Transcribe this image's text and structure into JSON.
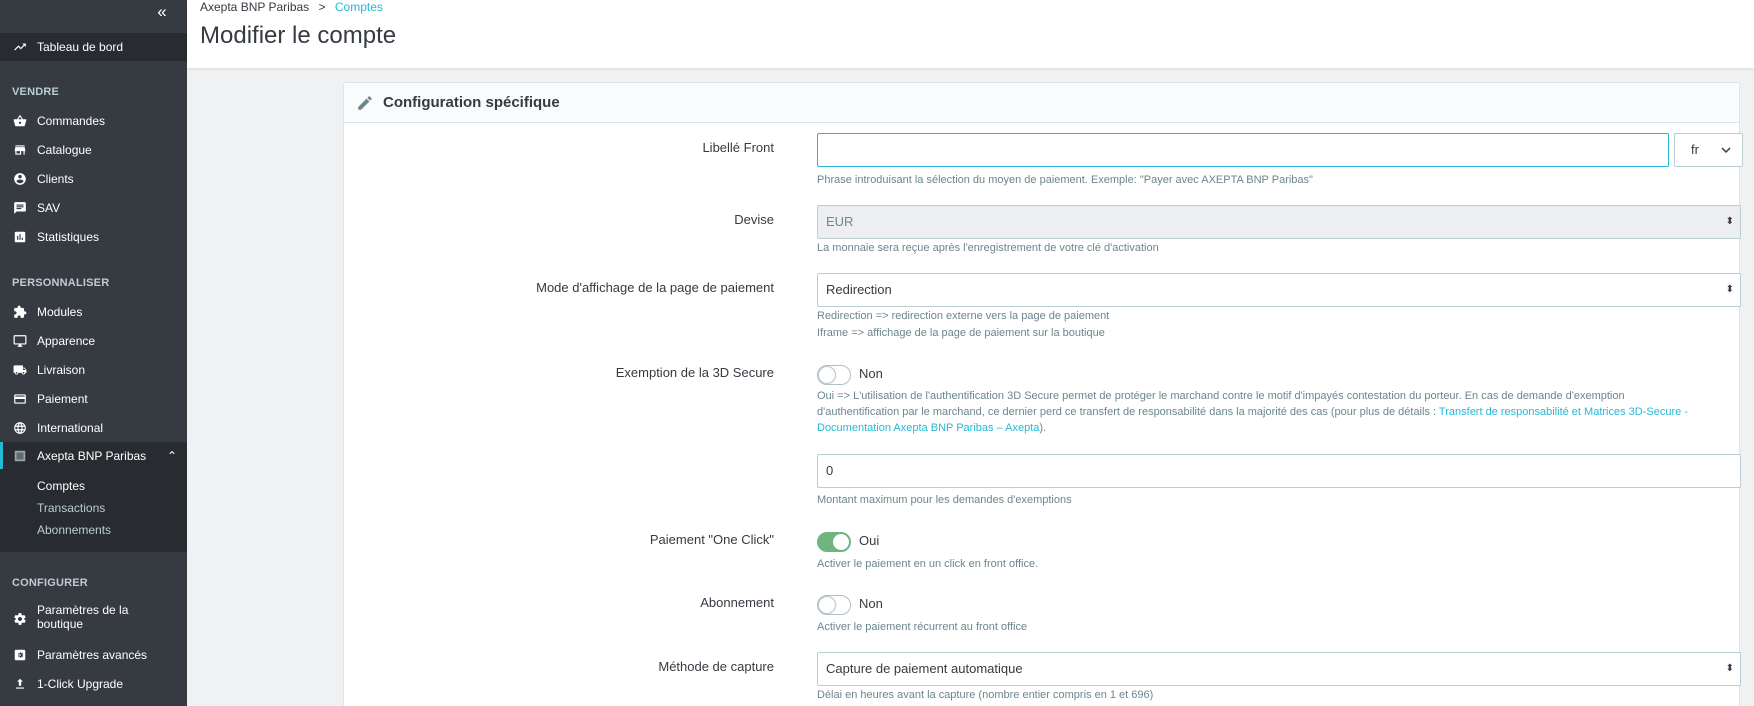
{
  "sidebar": {
    "collapse_icon": "double-chevron-left-icon",
    "dashboard": "Tableau de bord",
    "sections": {
      "sell": "VENDRE",
      "customize": "PERSONNALISER",
      "configure": "CONFIGURER"
    },
    "sell_items": [
      "Commandes",
      "Catalogue",
      "Clients",
      "SAV",
      "Statistiques"
    ],
    "customize_items": [
      "Modules",
      "Apparence",
      "Livraison",
      "Paiement",
      "International"
    ],
    "module": "Axepta BNP Paribas",
    "sub_items": [
      "Comptes",
      "Transactions",
      "Abonnements"
    ],
    "configure_items": [
      "Paramètres de la boutique",
      "Paramètres avancés",
      "1-Click Upgrade"
    ]
  },
  "header": {
    "breadcrumb_parent": "Axepta BNP Paribas",
    "breadcrumb_sep": ">",
    "breadcrumb_current": "Comptes",
    "title": "Modifier le compte"
  },
  "panel": {
    "title": "Configuration spécifique",
    "libelle": {
      "label": "Libellé Front",
      "value": "",
      "lang": "fr",
      "help": "Phrase introduisant la sélection du moyen de paiement. Exemple: \"Payer avec AXEPTA BNP Paribas\""
    },
    "devise": {
      "label": "Devise",
      "value": "EUR",
      "help": "La monnaie sera reçue après l'enregistrement de votre clé d'activation"
    },
    "mode": {
      "label": "Mode d'affichage de la page de paiement",
      "value": "Redirection",
      "help1": "Redirection => redirection externe vers la page de paiement",
      "help2": "Iframe => affichage de la page de paiement sur la boutique"
    },
    "exemption": {
      "label": "Exemption de la 3D Secure",
      "state": "Non",
      "help_line1": "Oui => L'utilisation de l'authentification 3D Secure permet de protéger le marchand contre le motif d'impayés contestation du porteur. En cas de demande d'exemption",
      "help_line2": "d'authentification par le marchand, ce dernier perd ce transfert de responsabilité dans la majorité des cas (pour plus de détails :",
      "link1": "Transfert de responsabilité et Matrices 3D-Secure -",
      "link2": "Documentation Axepta BNP Paribas – Axepta",
      "tail": ").",
      "amount": "0",
      "amount_help": "Montant maximum pour les demandes d'exemptions"
    },
    "oneclick": {
      "label": "Paiement \"One Click\"",
      "state": "Oui",
      "help": "Activer le paiement en un click en front office."
    },
    "abonnement": {
      "label": "Abonnement",
      "state": "Non",
      "help": "Activer le paiement récurrent au front office"
    },
    "capture": {
      "label": "Méthode de capture",
      "value": "Capture de paiement automatique",
      "help": "Délai en heures avant la capture (nombre entier compris en 1 et 696)"
    }
  }
}
